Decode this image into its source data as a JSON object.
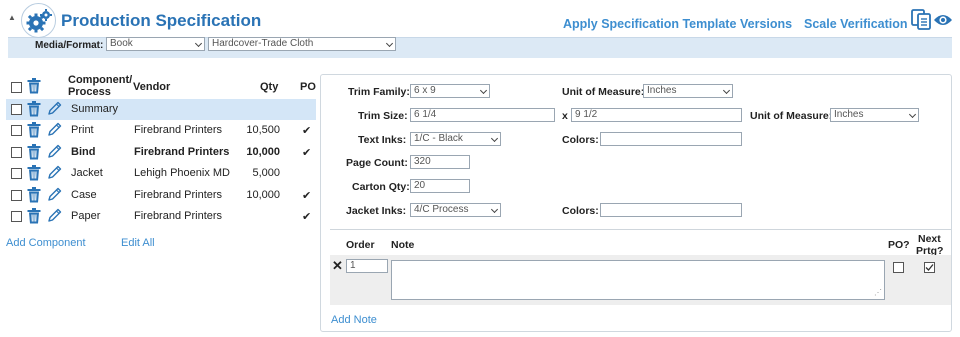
{
  "header": {
    "title": "Production Specification",
    "links": {
      "apply_template": "Apply Specification Template",
      "versions": "Versions",
      "scale_verification": "Scale Verification"
    },
    "collapse_glyph": "▲",
    "logo_icon": "gears-icon",
    "media_format": {
      "label": "Media/Format:",
      "media_value": "Book",
      "format_value": "Hardcover-Trade Cloth"
    }
  },
  "components": {
    "columns": {
      "component_process": "Component/ Process",
      "vendor": "Vendor",
      "qty": "Qty",
      "po": "PO"
    },
    "rows": [
      {
        "name": "Summary",
        "vendor": "",
        "qty": "",
        "po": ""
      },
      {
        "name": "Print",
        "vendor": "Firebrand Printers",
        "qty": "10,500",
        "po": "✔"
      },
      {
        "name": "Bind",
        "vendor": "Firebrand Printers",
        "qty": "10,000",
        "po": "✔"
      },
      {
        "name": "Jacket",
        "vendor": "Lehigh Phoenix MD",
        "qty": "5,000",
        "po": ""
      },
      {
        "name": "Case",
        "vendor": "Firebrand Printers",
        "qty": "10,000",
        "po": "✔"
      },
      {
        "name": "Paper",
        "vendor": "Firebrand Printers",
        "qty": "",
        "po": "✔"
      }
    ],
    "add_component": "Add Component",
    "edit_all": "Edit All"
  },
  "spec": {
    "trim_family": {
      "label": "Trim Family:",
      "value": "6 x 9"
    },
    "unit_of_measure_1": {
      "label": "Unit of Measure:",
      "value": "Inches"
    },
    "trim_size": {
      "label": "Trim Size:",
      "width": "6 1/4",
      "x": "x",
      "height": "9 1/2"
    },
    "unit_of_measure_2": {
      "label": "Unit of Measure:",
      "value": "Inches"
    },
    "text_inks": {
      "label": "Text Inks:",
      "value": "1/C - Black"
    },
    "text_colors": {
      "label": "Colors:",
      "value": ""
    },
    "page_count": {
      "label": "Page Count:",
      "value": "320"
    },
    "carton_qty": {
      "label": "Carton Qty:",
      "value": "20"
    },
    "jacket_inks": {
      "label": "Jacket Inks:",
      "value": "4/C Process"
    },
    "jacket_colors": {
      "label": "Colors:",
      "value": ""
    }
  },
  "notes": {
    "columns": {
      "order": "Order",
      "note": "Note",
      "po": "PO?",
      "next_prtg_1": "Next",
      "next_prtg_2": "Prtg?"
    },
    "rows": [
      {
        "delete": "✕",
        "order": "1",
        "note": "",
        "po_checked": false,
        "next_prtg_checked": true
      }
    ],
    "add_note": "Add Note"
  },
  "colors": {
    "accent": "#2a73b5",
    "link": "#3d8ed0",
    "header_bar": "#dce9f5",
    "selected_row": "#d4e6f7"
  }
}
